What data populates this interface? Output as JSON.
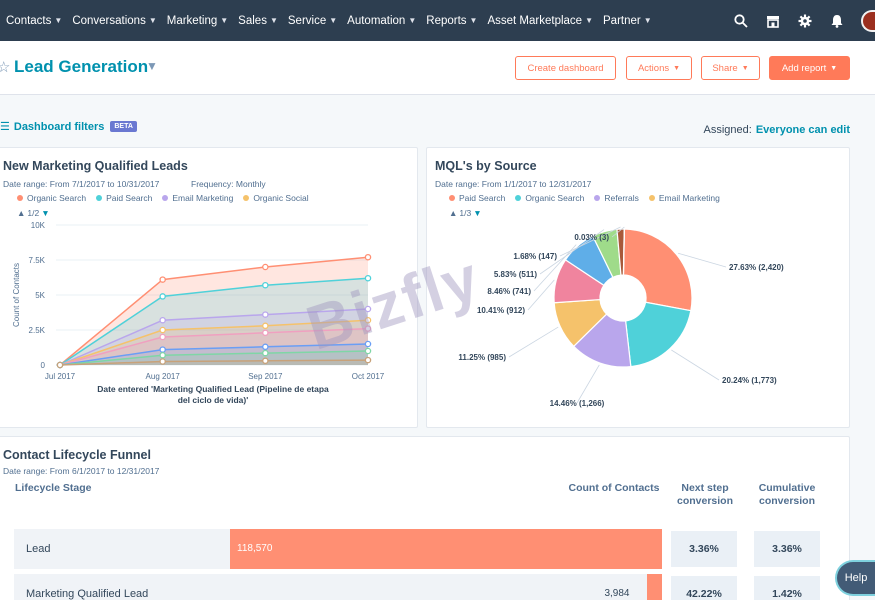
{
  "nav": {
    "items": [
      "Contacts",
      "Conversations",
      "Marketing",
      "Sales",
      "Service",
      "Automation",
      "Reports",
      "Asset Marketplace",
      "Partner"
    ],
    "icons": [
      "search-icon",
      "marketplace-icon",
      "gear-icon",
      "bell-icon"
    ]
  },
  "header": {
    "title": "Lead Generation",
    "buttons": {
      "create": "Create dashboard",
      "actions": "Actions",
      "share": "Share",
      "add_report": "Add report"
    }
  },
  "filters": {
    "label": "Dashboard filters",
    "badge": "BETA",
    "assigned_label": "Assigned:",
    "assigned_value": "Everyone can edit"
  },
  "mql_leads": {
    "title": "New Marketing Qualified Leads",
    "date_range": "Date range: From 7/1/2017 to 10/31/2017",
    "frequency": "Frequency: Monthly",
    "legend": [
      "Organic Search",
      "Paid Search",
      "Email Marketing",
      "Organic Social"
    ],
    "pager": "1/2"
  },
  "mql_source": {
    "title": "MQL's by Source",
    "date_range": "Date range: From 1/1/2017 to 12/31/2017",
    "legend": [
      "Paid Search",
      "Organic Search",
      "Referrals",
      "Email Marketing"
    ],
    "pager": "1/3"
  },
  "funnel": {
    "title": "Contact Lifecycle Funnel",
    "date_range": "Date range: From 6/1/2017 to 12/31/2017",
    "col_stage": "Lifecycle Stage",
    "col_count": "Count of Contacts",
    "col_next": [
      "Next step",
      "conversion"
    ],
    "col_cum": [
      "Cumulative",
      "conversion"
    ],
    "rows": [
      {
        "stage": "Lead",
        "count": "118,570",
        "count_value": 118570,
        "next": "3.36%",
        "cumulative": "3.36%"
      },
      {
        "stage": "Marketing Qualified Lead",
        "count": "3,984",
        "count_value": 3984,
        "next": "42.22%",
        "cumulative": "1.42%"
      }
    ]
  },
  "help": "Help",
  "watermark": "Bizfly",
  "colors": {
    "orange": "#ff7a59",
    "teal": "#0091ae",
    "series_organic_search": "#ff8f73",
    "series_paid_search": "#4fd1d9",
    "series_email_marketing": "#b9a6ec",
    "series_organic_social": "#f5c26b"
  },
  "chart_data": [
    {
      "type": "area",
      "title": "New Marketing Qualified Leads",
      "xlabel": "Date entered 'Marketing Qualified Lead (Pipeline de etapa del ciclo de vida)'",
      "ylabel": "Count of Contacts",
      "categories": [
        "Jul 2017",
        "Aug 2017",
        "Sep 2017",
        "Oct 2017"
      ],
      "yticks": [
        "0",
        "2.5K",
        "5K",
        "7.5K",
        "10K"
      ],
      "ylim": [
        0,
        10000
      ],
      "series": [
        {
          "name": "Organic Search",
          "color": "#ff8f73",
          "values": [
            0,
            6100,
            7000,
            7700
          ]
        },
        {
          "name": "Paid Search",
          "color": "#4fd1d9",
          "values": [
            0,
            4900,
            5700,
            6200
          ]
        },
        {
          "name": "Email Marketing",
          "color": "#b9a6ec",
          "values": [
            0,
            3200,
            3600,
            4000
          ]
        },
        {
          "name": "Organic Social",
          "color": "#f5c26b",
          "values": [
            0,
            2500,
            2800,
            3200
          ]
        },
        {
          "color": "#f0a0c0",
          "values": [
            0,
            2000,
            2300,
            2600
          ]
        },
        {
          "color": "#6a9ef5",
          "values": [
            0,
            1100,
            1300,
            1500
          ]
        },
        {
          "color": "#7fd6a6",
          "values": [
            0,
            700,
            850,
            1000
          ]
        },
        {
          "color": "#c8a27a",
          "values": [
            0,
            250,
            300,
            350
          ]
        }
      ]
    },
    {
      "type": "pie",
      "title": "MQL's by Source",
      "slices": [
        {
          "label": "27.63% (2,420)",
          "value": 27.63,
          "color": "#ff8f73"
        },
        {
          "label": "20.24% (1,773)",
          "value": 20.24,
          "color": "#4fd1d9"
        },
        {
          "label": "14.46% (1,266)",
          "value": 14.46,
          "color": "#b9a6ec"
        },
        {
          "label": "11.25% (985)",
          "value": 11.25,
          "color": "#f5c26b"
        },
        {
          "label": "10.41% (912)",
          "value": 10.41,
          "color": "#f0849e"
        },
        {
          "label": "8.46% (741)",
          "value": 8.46,
          "color": "#5faee8"
        },
        {
          "label": "5.83% (511)",
          "value": 5.83,
          "color": "#9fdb8a"
        },
        {
          "label": "1.68% (147)",
          "value": 1.68,
          "color": "#a8593a"
        },
        {
          "label": "0.03% (3)",
          "value": 0.03,
          "color": "#6a78d1"
        }
      ]
    }
  ]
}
